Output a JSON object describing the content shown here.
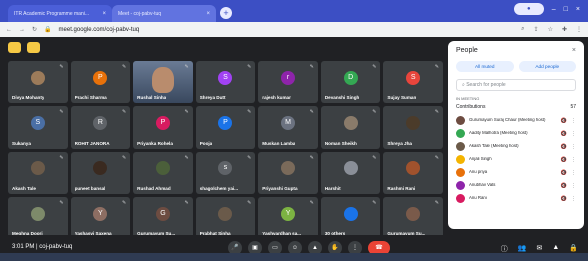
{
  "browser": {
    "tabs": [
      {
        "label": "ITR Academic Programme mani..."
      },
      {
        "label": "Meet - coj-pabv-tuq"
      }
    ],
    "url": "meet.google.com/coj-pabv-tuq"
  },
  "tiles": [
    {
      "name": "Divya Mohanty",
      "letter": "",
      "color": "#9c7b5a"
    },
    {
      "name": "Prachi Sharma",
      "letter": "P",
      "color": "#e8710a"
    },
    {
      "name": "Rushal Sinha",
      "letter": "",
      "color": ""
    },
    {
      "name": "Shreya Dutt",
      "letter": "S",
      "color": "#a142f4"
    },
    {
      "name": "rajesh kumar",
      "letter": "r",
      "color": "#8e24aa"
    },
    {
      "name": "Devanshi Singh",
      "letter": "D",
      "color": "#34a853"
    },
    {
      "name": "Sujay Suman",
      "letter": "S",
      "color": "#e8453c"
    },
    {
      "name": "Sukanya",
      "letter": "S",
      "color": "#4a6fa5"
    },
    {
      "name": "ROHIT JANORA",
      "letter": "R",
      "color": "#5f6368"
    },
    {
      "name": "Priyanka Rohela",
      "letter": "P",
      "color": "#d81b60"
    },
    {
      "name": "Pooja",
      "letter": "P",
      "color": "#1a73e8"
    },
    {
      "name": "Muskan Lamba",
      "letter": "M",
      "color": "#6b7280"
    },
    {
      "name": "Noman Sheikh",
      "letter": "",
      "color": "#8a7b6a"
    },
    {
      "name": "Shreya Jha",
      "letter": "",
      "color": "#4b3b2a"
    },
    {
      "name": "Akash Tale",
      "letter": "",
      "color": "#6b5a49"
    },
    {
      "name": "puneet bansal",
      "letter": "",
      "color": "#3a2a20"
    },
    {
      "name": "Rushad Ahmad",
      "letter": "",
      "color": "#4b5f3a"
    },
    {
      "name": "shagolchem yai...",
      "letter": "s",
      "color": "#5f6368"
    },
    {
      "name": "Priyanshi Gupta",
      "letter": "",
      "color": "#7a6a5a"
    },
    {
      "name": "Harshit",
      "letter": "",
      "color": "#8a8f98"
    },
    {
      "name": "Rashmi Rani",
      "letter": "",
      "color": "#a0522d"
    },
    {
      "name": "Meghna Doori",
      "letter": "",
      "color": "#7d8a6a"
    },
    {
      "name": "Yashasvi Saxena",
      "letter": "Y",
      "color": "#8d6e63"
    },
    {
      "name": "Gurumayum Su...",
      "letter": "G",
      "color": "#6d4c41"
    },
    {
      "name": "Prabhat Sinha",
      "letter": "",
      "color": "#6a5a4a"
    },
    {
      "name": "Yashvardhan sa...",
      "letter": "Y",
      "color": "#7cb342"
    },
    {
      "name": "30 others",
      "letter": "",
      "color": "#1a73e8"
    },
    {
      "name": "Gurumayum Su...",
      "letter": "",
      "color": "#7a5a4a"
    }
  ],
  "bottombar": {
    "time": "3:01 PM",
    "separator": "|",
    "meeting_code": "coj-pabv-tuq"
  },
  "people_panel": {
    "title": "People",
    "btn_all_muted": "All muted",
    "btn_add": "Add people",
    "search_placeholder": "Search for people",
    "in_meeting": "IN MEETING",
    "contributions": "Contributions",
    "contributions_count": "57",
    "participants": [
      {
        "name": "Gurumayum Suraj Chaur (Meeting host)",
        "color": "#6d4c41"
      },
      {
        "name": "Aadity Malhotra (Meeting host)",
        "color": "#34a853"
      },
      {
        "name": "Akash Tale (Meeting host)",
        "color": "#6b5a49"
      },
      {
        "name": "Anjali Singh",
        "color": "#f4b400"
      },
      {
        "name": "Anu priya",
        "color": "#e8710a"
      },
      {
        "name": "Anubhav Vats",
        "color": "#8e24aa"
      },
      {
        "name": "Anu Rani",
        "color": "#d81b60"
      }
    ]
  }
}
